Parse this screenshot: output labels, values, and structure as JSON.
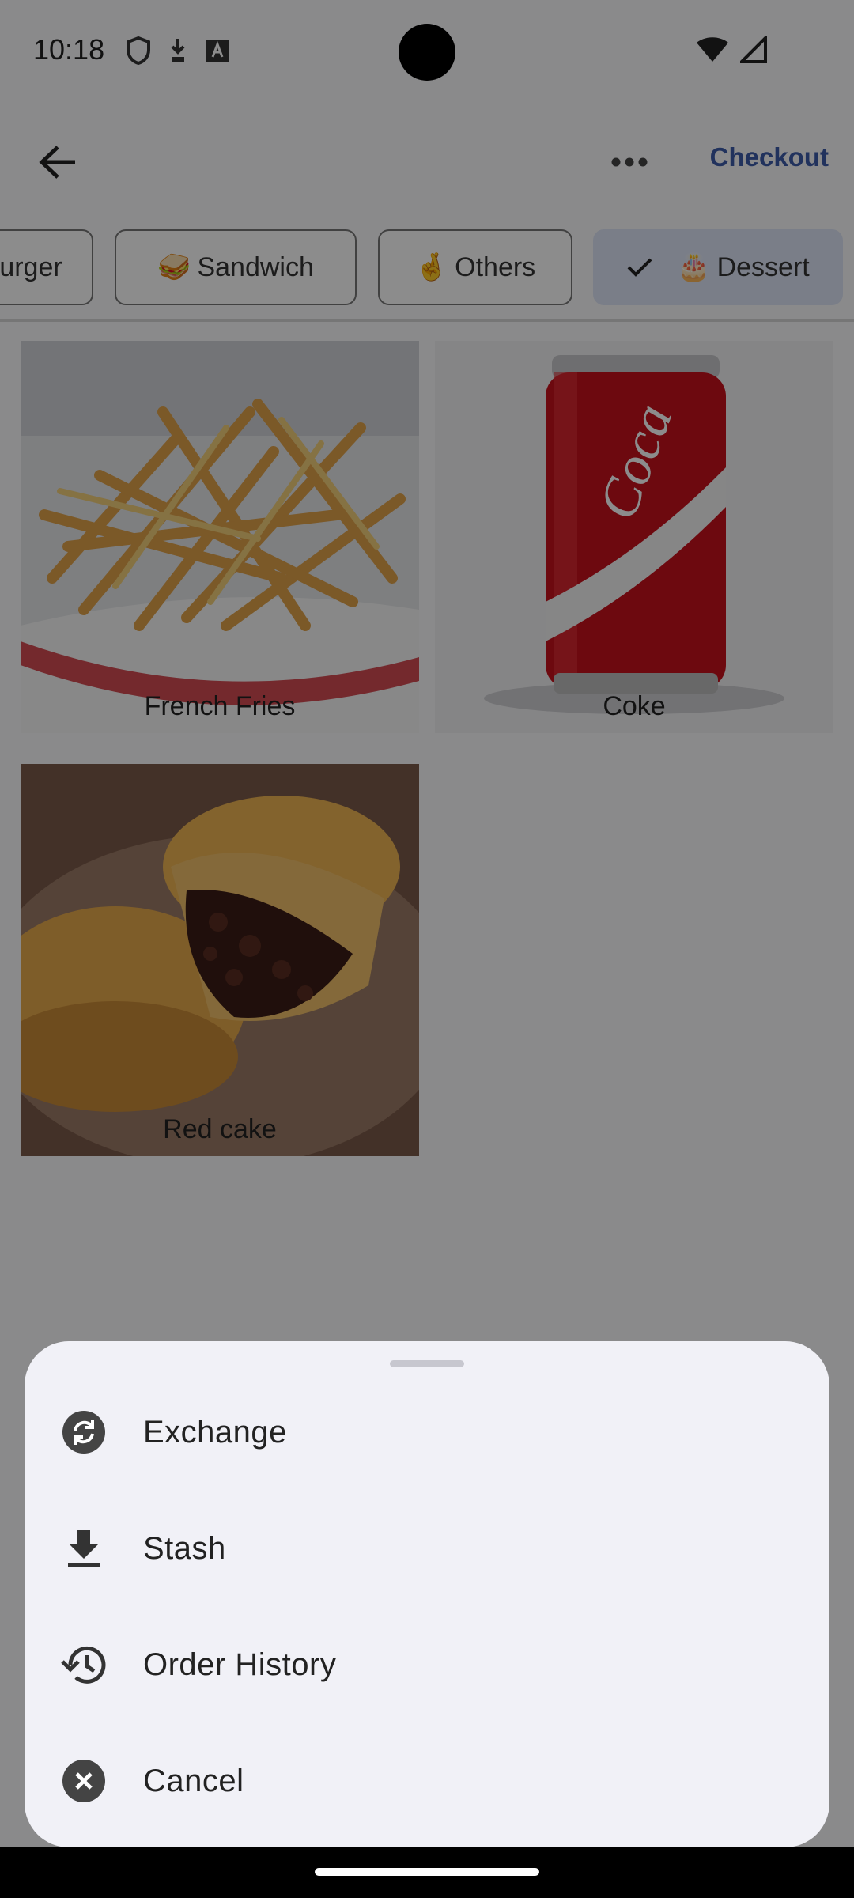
{
  "status_bar": {
    "time": "10:18",
    "left_icons": [
      "shield-icon",
      "download-sync-icon",
      "keyboard-a-icon"
    ],
    "right_icons": [
      "wifi-icon",
      "signal-icon"
    ]
  },
  "app_bar": {
    "back_icon": "arrow-back-icon",
    "more_icon": "more-horizontal-icon",
    "checkout_label": "Checkout"
  },
  "categories": [
    {
      "emoji": "",
      "label": "urger",
      "selected": false
    },
    {
      "emoji": "🥪",
      "label": "Sandwich",
      "selected": false
    },
    {
      "emoji": "🤞",
      "label": "Others",
      "selected": false
    },
    {
      "emoji": "🎂",
      "label": "Dessert",
      "selected": true
    }
  ],
  "products": [
    {
      "name": "French Fries",
      "image": "french-fries-image"
    },
    {
      "name": "Coke",
      "image": "coke-can-image"
    },
    {
      "name": "Red cake",
      "image": "red-bean-cake-image"
    }
  ],
  "bottom_sheet": {
    "items": [
      {
        "label": "Exchange",
        "icon": "exchange-icon"
      },
      {
        "label": "Stash",
        "icon": "download-icon"
      },
      {
        "label": "Order History",
        "icon": "history-icon"
      },
      {
        "label": "Cancel",
        "icon": "cancel-icon"
      }
    ]
  },
  "colors": {
    "accent": "#3d5ba9",
    "selected_chip": "#dfe6f8",
    "sheet_bg": "#f1f1f7",
    "scrim": "rgba(0,0,0,0.45)"
  }
}
